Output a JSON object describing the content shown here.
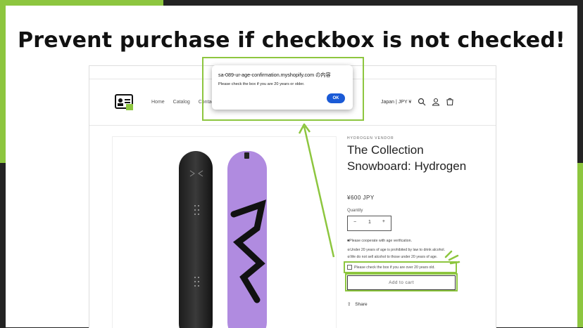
{
  "slide": {
    "headline": "Prevent purchase if checkbox is not checked!"
  },
  "header": {
    "nav": [
      "Home",
      "Catalog",
      "Contact"
    ],
    "country": "Japan | JPY ¥",
    "icons": [
      "search-icon",
      "account-icon",
      "cart-icon"
    ]
  },
  "product": {
    "vendor": "HYDROGEN VENDOR",
    "title": "The Collection Snowboard: Hydrogen",
    "price": "¥600 JPY",
    "quantity_label": "Quantity",
    "quantity": {
      "minus": "−",
      "value": "1",
      "plus": "+"
    },
    "note_cooperate": "■Please cooperate with age verification.",
    "note_prohibited": "※Under 20 years of age is prohibited by law to drink alcohol.",
    "note_no_sell": "※We do not sell alcohol to those under 20 years of age.",
    "checkbox_label": "Please check the box if you are over 20 years old.",
    "add_to_cart": "Add to cart",
    "share": "Share"
  },
  "dialog": {
    "title": "sa-089-ur-age-confirmation.myshopify.com の内容",
    "message": "Please check the box if you are 20 years or older.",
    "ok": "OK"
  },
  "colors": {
    "accent_green": "#8dc63f",
    "ok_blue": "#1a5ad6",
    "board_purple": "#b08be0"
  }
}
